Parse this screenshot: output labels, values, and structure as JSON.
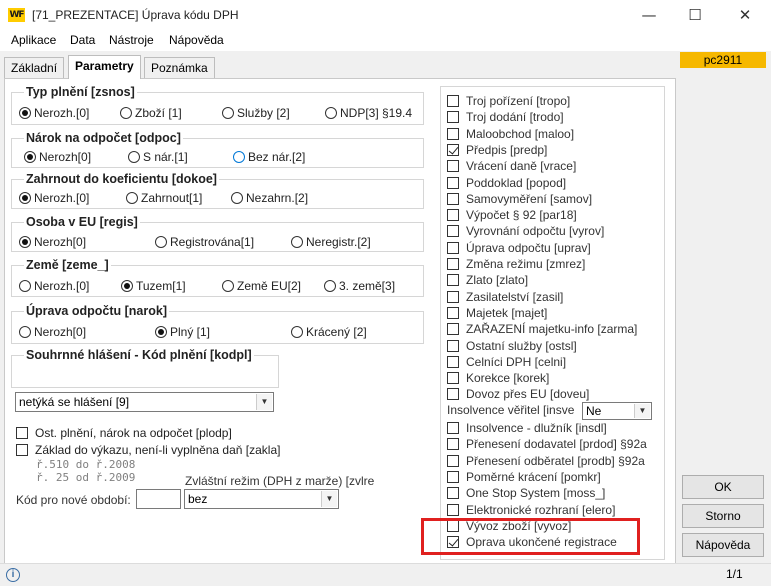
{
  "window": {
    "title": "[71_PREZENTACE] Úprava kódu DPH",
    "app_icon": "WF",
    "minimize_glyph": "—",
    "maximize_glyph": "☐",
    "close_glyph": "✕"
  },
  "menu": [
    "Aplikace",
    "Data",
    "Nástroje",
    "Nápověda"
  ],
  "tabs": [
    {
      "label": "Základní"
    },
    {
      "label": "Parametry",
      "active": true
    },
    {
      "label": "Poznámka"
    }
  ],
  "badge": "pc2911",
  "groups": {
    "typ_plneni": {
      "title": "Typ plnění [zsnos]",
      "options": [
        "Nerozh.[0]",
        "Zboží [1]",
        "Služby [2]",
        "NDP[3] §19.4"
      ],
      "selected": 0
    },
    "narok": {
      "title": "Nárok na odpočet [odpoc]",
      "options": [
        "Nerozh[0]",
        "S nár.[1]",
        "Bez nár.[2]"
      ],
      "selected": 0
    },
    "zahrnout": {
      "title": "Zahrnout do koeficientu [dokoe]",
      "options": [
        "Nerozh.[0]",
        "Zahrnout[1]",
        "Nezahrn.[2]"
      ],
      "selected": 0
    },
    "osoba": {
      "title": "Osoba v EU [regis]",
      "options": [
        "Nerozh[0]",
        "Registrována[1]",
        "Neregistr.[2]"
      ],
      "selected": 0
    },
    "zeme": {
      "title": "Země [zeme_]",
      "options": [
        "Nerozh.[0]",
        "Tuzem[1]",
        "Země EU[2]",
        "3. země[3]"
      ],
      "selected": 1
    },
    "uprava": {
      "title": "Úprava odpočtu [narok]",
      "options": [
        "Nerozh[0]",
        "Plný [1]",
        "Krácený [2]"
      ],
      "selected": 1
    },
    "souhrnne": {
      "title": "Souhrnné hlášení - Kód plnění [kodpl]",
      "value": "netýká se hlášení [9]"
    }
  },
  "lower_left": {
    "ost_plneni": "Ost. plnění, nárok na odpočet [plodp]",
    "zaklad": "Základ do výkazu, není-li vyplněna daň [zakla]",
    "hint1": "ř.510 do ř.2008",
    "hint2": "ř. 25 od ř.2009",
    "zvlastni_label": "Zvláštní režim (DPH z marže) [zvlre",
    "zvlastni_value": "bez",
    "kod_label": "Kód pro nové období:",
    "kod_value": ""
  },
  "checkboxes": [
    {
      "label": "Troj pořízení [tropo]",
      "checked": false
    },
    {
      "label": "Troj dodání [trodo]",
      "checked": false
    },
    {
      "label": "Maloobchod [maloo]",
      "checked": false
    },
    {
      "label": "Předpis [predp]",
      "checked": true
    },
    {
      "label": "Vrácení daně [vrace]",
      "checked": false
    },
    {
      "label": "Poddoklad [popod]",
      "checked": false
    },
    {
      "label": "Samovyměření [samov]",
      "checked": false
    },
    {
      "label": "Výpočet § 92 [par18]",
      "checked": false
    },
    {
      "label": "Vyrovnání odpočtu [vyrov]",
      "checked": false
    },
    {
      "label": "Úprava odpočtu [uprav]",
      "checked": false
    },
    {
      "label": "Změna režimu [zmrez]",
      "checked": false
    },
    {
      "label": "Zlato [zlato]",
      "checked": false
    },
    {
      "label": "Zasilatelství [zasil]",
      "checked": false
    },
    {
      "label": "Majetek [majet]",
      "checked": false
    },
    {
      "label": "ZAŘAZENÍ majetku-info [zarma]",
      "checked": false
    },
    {
      "label": "Ostatní služby [ostsl]",
      "checked": false
    },
    {
      "label": "Celníci DPH [celni]",
      "checked": false
    },
    {
      "label": "Korekce [korek]",
      "checked": false
    },
    {
      "label": "Dovoz přes EU [doveu]",
      "checked": false
    }
  ],
  "insolvence": {
    "label": "Insolvence věřitel [insve",
    "value": "Ne"
  },
  "checkboxes2": [
    {
      "label": "Insolvence - dlužník [insdl]",
      "checked": false
    },
    {
      "label": "Přenesení dodavatel [prdod] §92a",
      "checked": false
    },
    {
      "label": "Přenesení odběratel [prodb] §92a",
      "checked": false
    },
    {
      "label": "Poměrné krácení [pomkr]",
      "checked": false
    },
    {
      "label": "One Stop System [moss_]",
      "checked": false
    },
    {
      "label": "Elektronické rozhraní [elero]",
      "checked": false
    },
    {
      "label": "Vývoz zboží [vyvoz]",
      "checked": false
    },
    {
      "label": "Oprava ukončené registrace",
      "checked": true
    }
  ],
  "buttons": {
    "ok": "OK",
    "storno": "Storno",
    "napoveda": "Nápověda"
  },
  "status": {
    "page": "1/1",
    "info_glyph": "i"
  }
}
